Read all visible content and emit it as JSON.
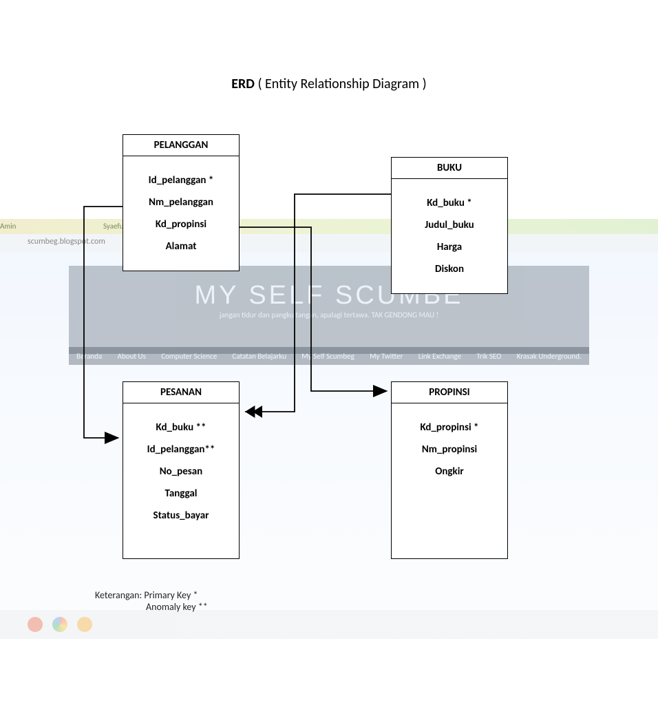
{
  "title": {
    "main": "ERD",
    "sub": "( Entity Relationship Diagram )"
  },
  "entities": {
    "pelanggan": {
      "name": "PELANGGAN",
      "attrs": [
        "Id_pelanggan *",
        "Nm_pelanggan",
        "Kd_propinsi",
        "Alamat"
      ]
    },
    "buku": {
      "name": "BUKU",
      "attrs": [
        "Kd_buku *",
        "Judul_buku",
        "Harga",
        "Diskon"
      ]
    },
    "pesanan": {
      "name": "PESANAN",
      "attrs": [
        "Kd_buku **",
        "Id_pelanggan**",
        "No_pesan",
        "Tanggal",
        "Status_bayar"
      ]
    },
    "propinsi": {
      "name": "PROPINSI",
      "attrs": [
        "Kd_propinsi *",
        "Nm_propinsi",
        "Ongkir"
      ]
    }
  },
  "legend": {
    "line1": "Keterangan: Primary Key *",
    "line2": "Anomaly key **"
  },
  "background": {
    "tab1": "Amin",
    "tab2": "Syaeful Amin (sya...            ful Am...  My Self S...",
    "url": "scumbeg.blogspot.com",
    "banner_title": "MY SELF SCUMBE",
    "banner_sub": "jangan tidur dan pangku tangan, apalagi tertawa. TAK GENDONG MAU !",
    "nav": [
      "Beranda",
      "About Us",
      "Computer Science",
      "Catatan Belajarku",
      "My Self Scumbeg",
      "My Twitter",
      "Link Exchange",
      "Trik SEO",
      "Krasak Underground."
    ]
  }
}
